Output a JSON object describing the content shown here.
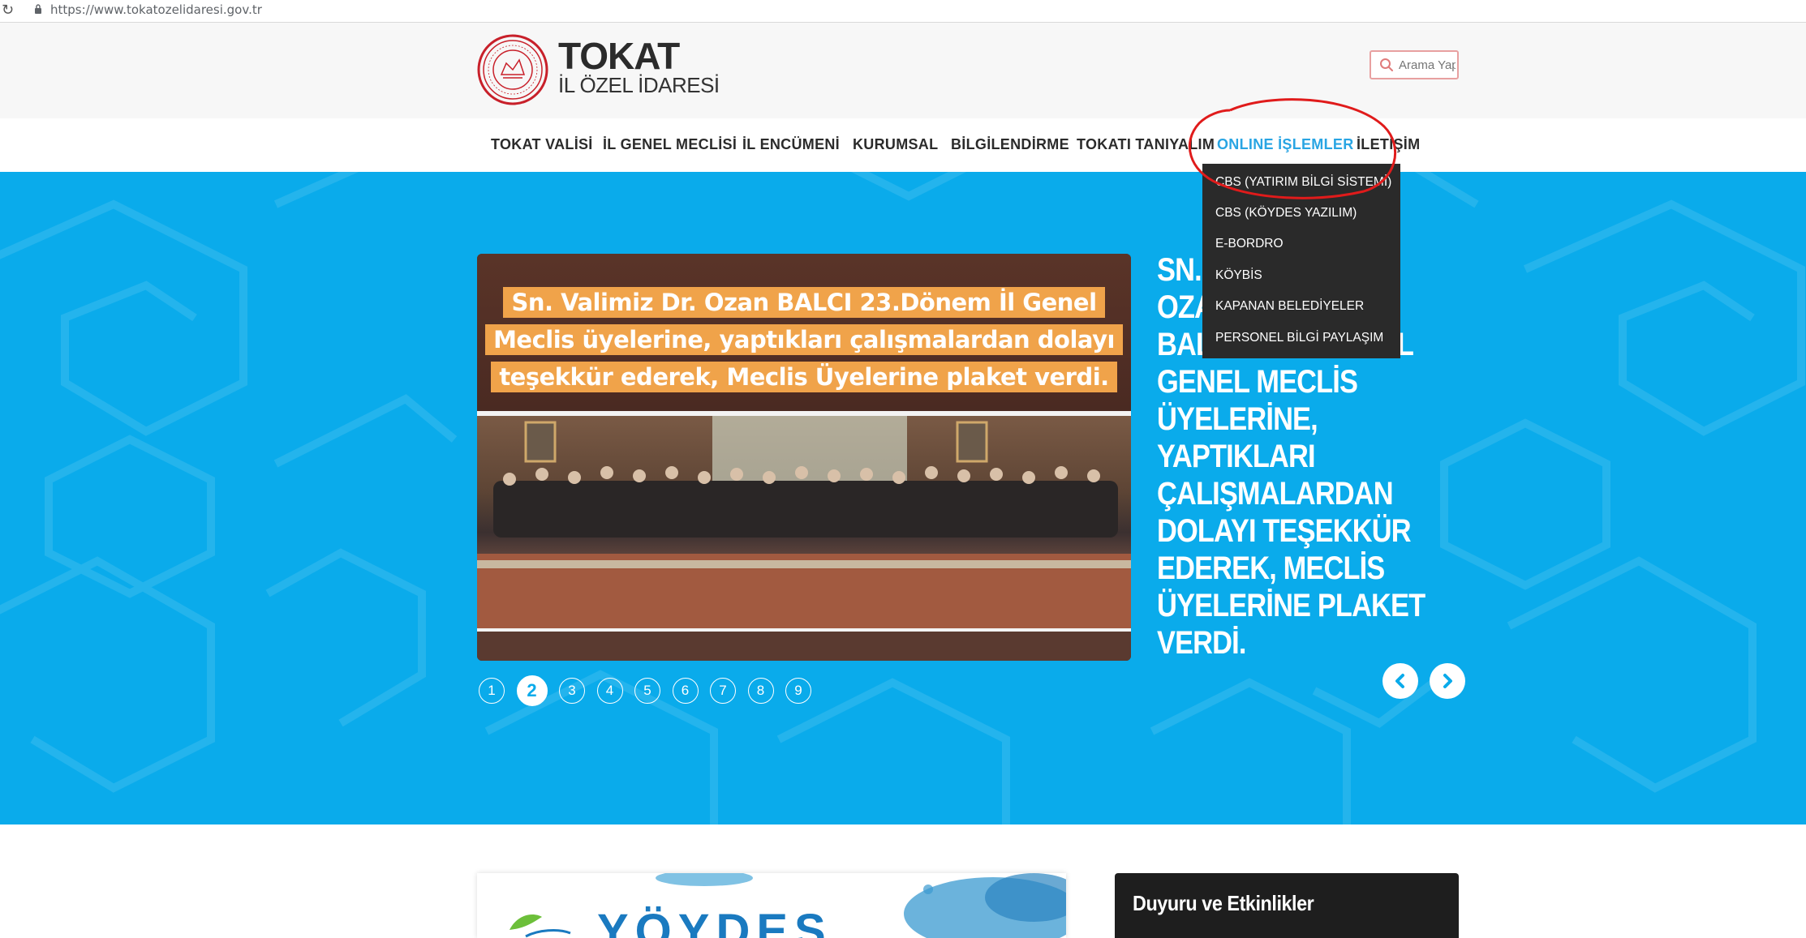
{
  "browser": {
    "url": "https://www.tokatozelidaresi.gov.tr",
    "reload_icon": "reload-icon",
    "lock_icon": "lock-icon"
  },
  "header": {
    "logo_icon": "seal-logo-icon",
    "title": "TOKAT",
    "subtitle": "İL ÖZEL İDARESİ",
    "search_placeholder": "Arama Yap",
    "search_icon": "search-icon"
  },
  "nav": {
    "items": [
      {
        "label": "TOKAT VALİSİ"
      },
      {
        "label": "İL GENEL MECLİSİ"
      },
      {
        "label": "İL ENCÜMENİ"
      },
      {
        "label": "KURUMSAL"
      },
      {
        "label": "BİLGİLENDİRME"
      },
      {
        "label": "TOKATI TANIYALIM"
      },
      {
        "label": "ONLINE İŞLEMLER"
      },
      {
        "label": "İLETİŞİM"
      }
    ],
    "active_color": "#29a5e3"
  },
  "dropdown": {
    "items": [
      {
        "label": "CBS (YATIRIM BİLGİ SİSTEMİ)"
      },
      {
        "label": "CBS (KÖYDES YAZILIM)"
      },
      {
        "label": "E-BORDRO"
      },
      {
        "label": "KÖYBİS"
      },
      {
        "label": "KAPANAN BELEDİYELER"
      },
      {
        "label": "PERSONEL BİLGİ PAYLAŞIM"
      }
    ]
  },
  "slider": {
    "image_lines": [
      "Sn. Valimiz Dr. Ozan BALCI 23.Dönem İl Genel",
      "Meclis üyelerine, yaptıkları çalışmalardan dolayı",
      "teşekkür ederek, Meclis Üyelerine plaket verdi."
    ],
    "headline_lines": [
      "SN. VALİMİZ DR. OZAN",
      "BALCI 23.DÖNEM İL",
      "GENEL MECLİS",
      "ÜYELERİNE, YAPTIKLARI",
      "ÇALIŞMALARDAN",
      "DOLAYI TEŞEKKÜR",
      "EDEREK, MECLİS",
      "ÜYELERİNE PLAKET",
      "VERDİ."
    ],
    "pages": [
      "1",
      "2",
      "3",
      "4",
      "5",
      "6",
      "7",
      "8",
      "9"
    ],
    "active_page": "2",
    "prev_icon": "chevron-left-icon",
    "next_icon": "chevron-right-icon",
    "background_color": "#0aabeb"
  },
  "lower": {
    "banner_text": "YÖYDES",
    "announcements_title": "Duyuru ve Etkinlikler"
  },
  "annotation": {
    "color": "#e01b1b"
  }
}
